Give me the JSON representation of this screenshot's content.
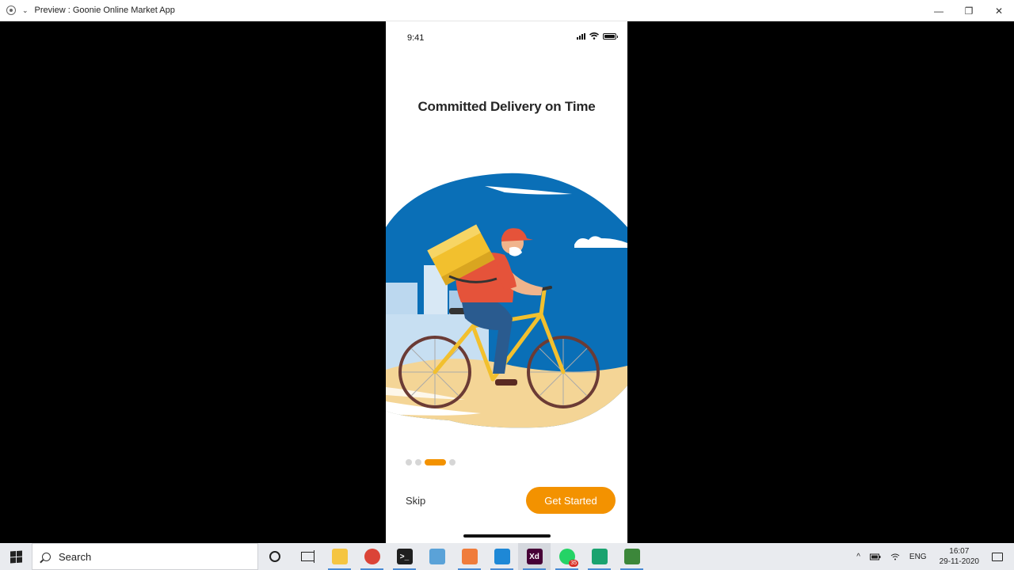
{
  "window": {
    "title": "Preview : Goonie Online Market App",
    "minimize": "—",
    "restore": "❐",
    "close": "✕"
  },
  "phone": {
    "status_time": "9:41",
    "heading": "Committed Delivery on Time",
    "illustration_icon": "delivery-cyclist-illustration",
    "pager": {
      "count": 4,
      "active_index": 2
    },
    "skip_label": "Skip",
    "cta_label": "Get Started",
    "accent_color": "#f39200",
    "sky_color": "#0a6fb7",
    "sand_color": "#f4d596"
  },
  "taskbar": {
    "search_label": "Search",
    "apps": [
      {
        "name": "file-explorer",
        "color": "#f5c542",
        "glyph": "",
        "open": true
      },
      {
        "name": "chrome",
        "color": "#db4437",
        "glyph": "",
        "open": true
      },
      {
        "name": "terminal",
        "color": "#1f1f1f",
        "glyph": ">_",
        "open": true
      },
      {
        "name": "notepad",
        "color": "#5aa2d8",
        "glyph": "",
        "open": false
      },
      {
        "name": "xampp",
        "color": "#f07c3b",
        "glyph": "",
        "open": true
      },
      {
        "name": "vscode",
        "color": "#1e88d6",
        "glyph": "",
        "open": true
      },
      {
        "name": "adobe-xd",
        "color": "#470137",
        "glyph": "Xd",
        "open": true
      },
      {
        "name": "whatsapp",
        "color": "#25d366",
        "glyph": "",
        "open": true,
        "badge": "35"
      },
      {
        "name": "reader",
        "color": "#1aa36f",
        "glyph": "",
        "open": true
      },
      {
        "name": "node",
        "color": "#3c873a",
        "glyph": "",
        "open": true
      }
    ],
    "tray": {
      "chevron": "^",
      "language": "ENG",
      "time": "16:07",
      "date": "29-11-2020"
    }
  }
}
